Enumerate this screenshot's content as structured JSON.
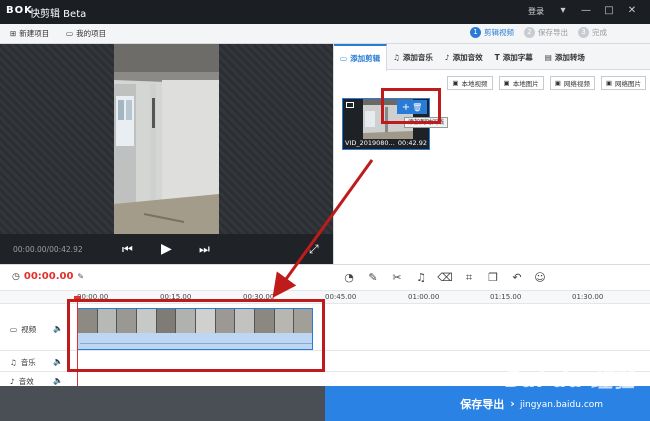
{
  "titlebar": {
    "logo": "BOK",
    "app_name": "快剪辑 Beta",
    "login": "登录"
  },
  "menubar": {
    "new_project": "新建项目",
    "my_projects": "我的项目",
    "steps": [
      {
        "num": "1",
        "label": "剪辑视频"
      },
      {
        "num": "2",
        "label": "保存导出"
      },
      {
        "num": "3",
        "label": "完成"
      }
    ]
  },
  "player": {
    "time": "00:00.00/00:42.92"
  },
  "tabs": [
    "添加剪辑",
    "添加音乐",
    "添加音效",
    "添加字幕",
    "添加转场"
  ],
  "subbuttons": [
    "本地视频",
    "本地图片",
    "网络视频",
    "网络图片"
  ],
  "clip": {
    "name": "VID_2019080...",
    "duration": "00:42.92",
    "tooltip": "添加到时间线"
  },
  "edit": {
    "timecode": "00:00.00"
  },
  "ruler": [
    "00:00.00",
    "00:15.00",
    "00:30.00",
    "00:45.00",
    "01:00.00",
    "01:15.00",
    "01:30.00"
  ],
  "tracks": {
    "video": "视频",
    "music": "音乐",
    "sfx": "音效"
  },
  "export": {
    "label": "保存导出"
  },
  "watermark": {
    "text": "jingyan.baidu.com"
  },
  "colors": {
    "accent": "#2a7bd6",
    "annotation": "#c01b1b",
    "export_bg": "#2a82e4"
  }
}
